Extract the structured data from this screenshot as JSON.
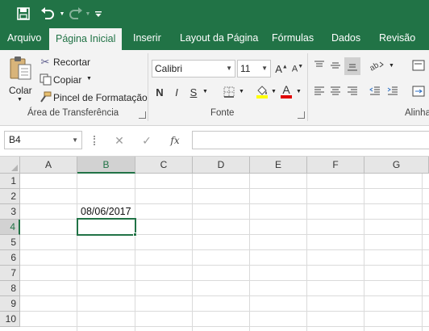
{
  "quick_access": {
    "save_icon": "save-icon",
    "undo_icon": "undo-icon",
    "redo_icon": "redo-icon",
    "customize_icon": "customize-toolbar-icon"
  },
  "tabs": [
    {
      "label": "Arquivo"
    },
    {
      "label": "Página Inicial",
      "active": true
    },
    {
      "label": "Inserir"
    },
    {
      "label": "Layout da Página"
    },
    {
      "label": "Fórmulas"
    },
    {
      "label": "Dados"
    },
    {
      "label": "Revisão"
    }
  ],
  "clipboard": {
    "paste_label": "Colar",
    "cut_label": "Recortar",
    "copy_label": "Copiar",
    "format_painter_label": "Pincel de Formatação",
    "group_label": "Área de Transferência"
  },
  "font": {
    "font_name": "Calibri",
    "font_size": "11",
    "bold": "N",
    "italic": "I",
    "underline": "S",
    "font_color_letter": "A",
    "grow_letter": "A",
    "shrink_letter": "A",
    "group_label": "Fonte"
  },
  "alignment": {
    "group_label": "Alinha"
  },
  "formula_bar": {
    "name_box": "B4",
    "cancel_symbol": "✕",
    "enter_symbol": "✓",
    "function_symbol": "fx",
    "formula": ""
  },
  "sheet": {
    "columns": [
      "A",
      "B",
      "C",
      "D",
      "E",
      "F",
      "G"
    ],
    "rows": [
      "1",
      "2",
      "3",
      "4",
      "5",
      "6",
      "7",
      "8",
      "9",
      "10"
    ],
    "selected_column": "B",
    "selected_row": "4",
    "cells": {
      "B3": "08/06/2017"
    }
  },
  "colors": {
    "accent": "#217346",
    "ribbon_bg": "#f3f3f3",
    "highlight_yellow": "#ffff00",
    "font_red": "#e00000"
  }
}
